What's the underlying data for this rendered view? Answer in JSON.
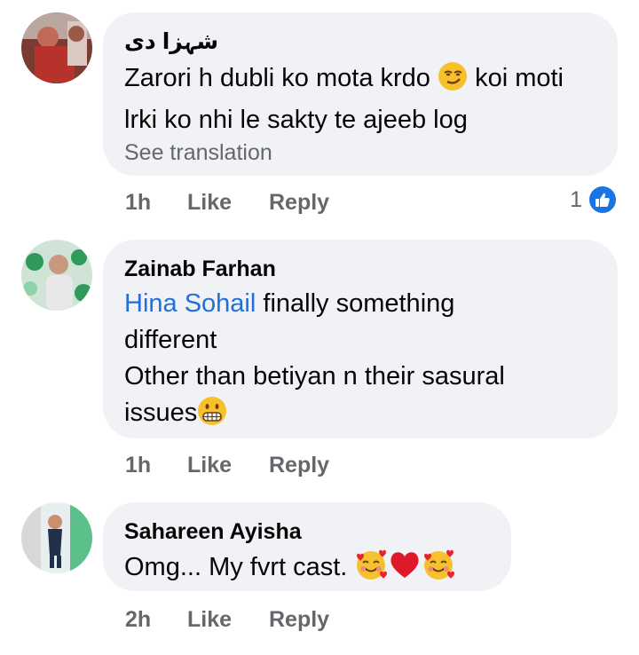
{
  "comments": [
    {
      "author": "شہزا دی",
      "text_before": "Zarori h dubli ko mota krdo",
      "text_after": "koi moti lrki ko nhi le sakty te ajeeb log",
      "see_translation": "See translation",
      "time": "1h",
      "like_label": "Like",
      "reply_label": "Reply",
      "reaction_count": "1",
      "emoji": "smirk-icon"
    },
    {
      "author": "Zainab Farhan",
      "mention": "Hina Sohail",
      "text_line1": "finally something",
      "text_line2": "different",
      "text_line3": "Other than betiyan n their sasural",
      "text_line4": "issues",
      "time": "1h",
      "like_label": "Like",
      "reply_label": "Reply",
      "emoji": "grimace-icon"
    },
    {
      "author": "Sahareen Ayisha",
      "text": "Omg... My fvrt cast.",
      "time": "2h",
      "like_label": "Like",
      "reply_label": "Reply",
      "emojis": [
        "smiling-face-with-hearts-icon",
        "red-heart-icon",
        "smiling-face-with-hearts-icon"
      ]
    }
  ],
  "colors": {
    "bubble": "#f0f2f5",
    "mention": "#216fdb",
    "secondary_text": "#65676b",
    "like_blue": "#1b74e4"
  }
}
